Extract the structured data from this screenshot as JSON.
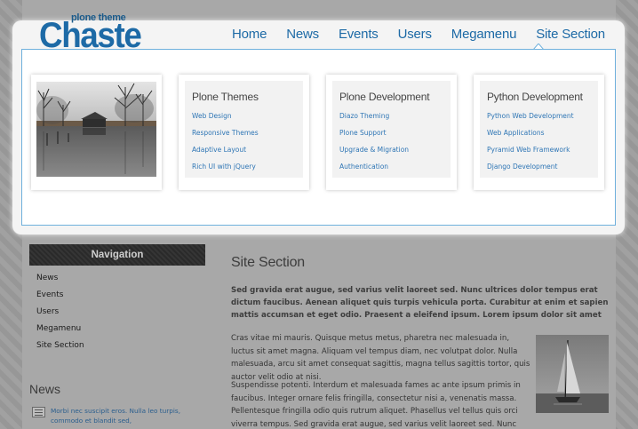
{
  "logo": {
    "tagline": "plone theme",
    "name": "Chaste"
  },
  "menu": {
    "items": [
      {
        "label": "Home"
      },
      {
        "label": "News"
      },
      {
        "label": "Events"
      },
      {
        "label": "Users"
      },
      {
        "label": "Megamenu"
      },
      {
        "label": "Site Section"
      }
    ],
    "active": "Site Section",
    "accent_color": "#1d6aa6"
  },
  "megamenu": {
    "columns": [
      {
        "title": "Plone Themes",
        "links": [
          "Web Design",
          "Responsive Themes",
          "Adaptive Layout",
          "Rich UI with jQuery"
        ]
      },
      {
        "title": "Plone Development",
        "links": [
          "Diazo Theming",
          "Plone Support",
          "Upgrade & Migration",
          "Authentication"
        ]
      },
      {
        "title": "Python Development",
        "links": [
          "Python Web Development",
          "Web Applications",
          "Pyramid Web Framework",
          "Django Development"
        ]
      }
    ]
  },
  "sidebar": {
    "navigation_title": "Navigation",
    "items": [
      "News",
      "Events",
      "Users",
      "Megamenu",
      "Site Section"
    ],
    "news_title": "News",
    "news_item": "Morbi nec suscipit eros. Nulla leo turpis, commodo et blandit sed,"
  },
  "main": {
    "title": "Site Section",
    "lead": "Sed gravida erat augue, sed varius velit laoreet sed. Nunc ultrices dolor tempus erat dictum faucibus. Aenean aliquet quis turpis vehicula porta. Curabitur at enim et sapien mattis accumsan et eget odio. Praesent a eleifend ipsum. Lorem ipsum dolor sit amet",
    "paragraph1": "Cras vitae mi mauris. Quisque metus metus, pharetra nec malesuada in, luctus sit amet magna. Aliquam vel tempus diam, nec volutpat dolor. Nulla malesuada, arcu sit amet consequat sagittis, magna tellus sagittis tortor, quis auctor velit odio at nisi.",
    "paragraph2": "Suspendisse potenti. Interdum et malesuada fames ac ante ipsum primis in faucibus. Integer ornare felis fringilla, consectetur nisi a, venenatis massa. Pellentesque fringilla odio quis rutrum aliquet. Phasellus vel tellus quis orci viverra tempus. Sed gravida erat augue, sed varius velit laoreet sed. Nunc ultrices dolor tempus erat dictum"
  }
}
